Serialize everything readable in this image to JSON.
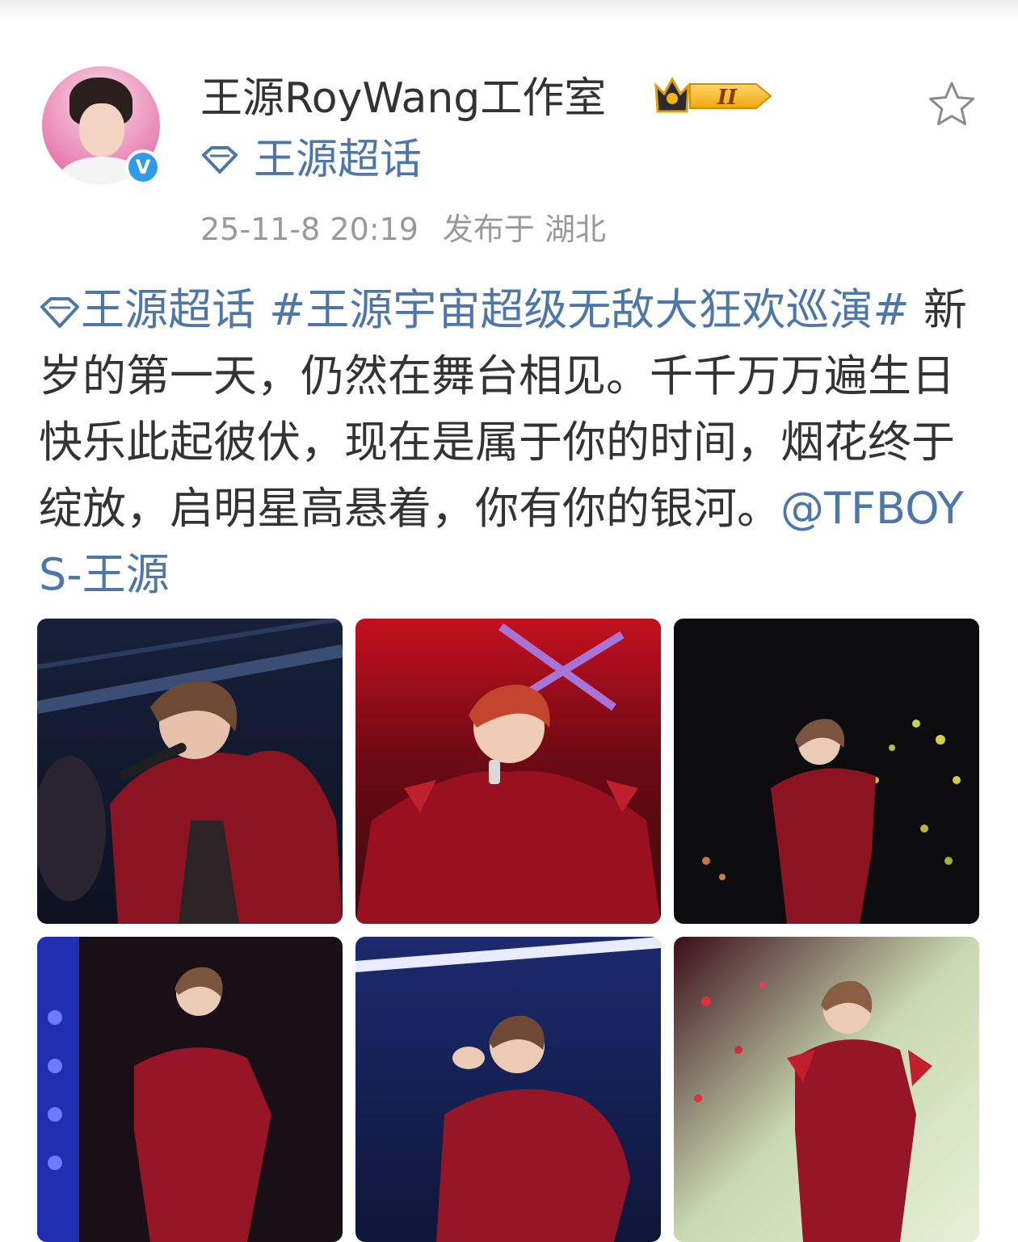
{
  "post": {
    "author": {
      "name": "王源RoyWang工作室",
      "verified": true,
      "badge_level": "II",
      "topic_label": "王源超话"
    },
    "time": "25-11-8 20:19",
    "location": "发布于 湖北",
    "body": {
      "topic": "王源超话",
      "hashtag": "#王源宇宙超级无敌大狂欢巡演#",
      "text": " 新岁的第一天，仍然在舞台相见。千千万万遍生日快乐此起彼伏，现在是属于你的时间，烟花终于绽放，启明星高悬着，你有你的银河。",
      "mention": "@TFBOYS-王源"
    },
    "photos": [
      {
        "subject": "performer in red sequin suit singing, dark stage lighting"
      },
      {
        "subject": "performer with red hair singing under red and purple lights"
      },
      {
        "subject": "performer on dark stage with yellow bokeh lights"
      },
      {
        "subject": "performer singing with blue dotted backdrop"
      },
      {
        "subject": "performer seated on chair, gesturing, blue stage"
      },
      {
        "subject": "performer standing before bright screen with red glitter"
      }
    ]
  },
  "colors": {
    "link_blue": "#4d77a8",
    "text": "#333333",
    "meta_gray": "#999999",
    "verified_blue": "#2f9bea",
    "badge_gold": "#f5b319"
  },
  "icons": {
    "topic": "diamond-icon",
    "favorite": "star-outline-icon",
    "verified": "verified-v-icon",
    "badge": "crown-badge-icon"
  }
}
